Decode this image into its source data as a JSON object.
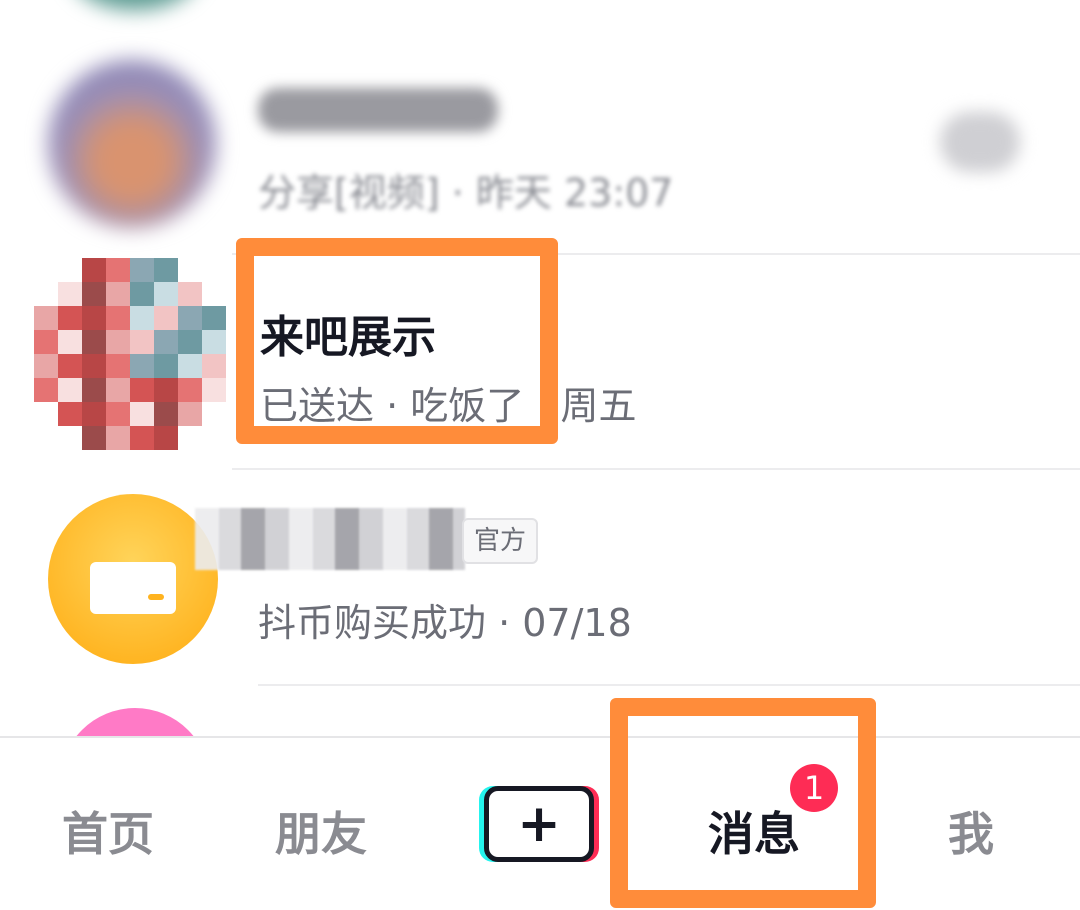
{
  "conversations": [
    {
      "name": "",
      "preview": "分享[视频] · 昨天 23:07"
    },
    {
      "name": "来吧展示",
      "preview_prefix": "已送达 · 吃饭了",
      "preview_suffix": " · 周五"
    },
    {
      "name": "",
      "tag": "官方",
      "preview": "抖币购买成功 · 07/18"
    }
  ],
  "tabbar": {
    "home": "首页",
    "friends": "朋友",
    "add": "+",
    "messages": "消息",
    "messages_badge": "1",
    "me": "我"
  },
  "colors": {
    "highlight": "#ff8c3a",
    "badge": "#fe2c55",
    "primary_text": "#161823",
    "secondary_text": "#6b6d76"
  }
}
